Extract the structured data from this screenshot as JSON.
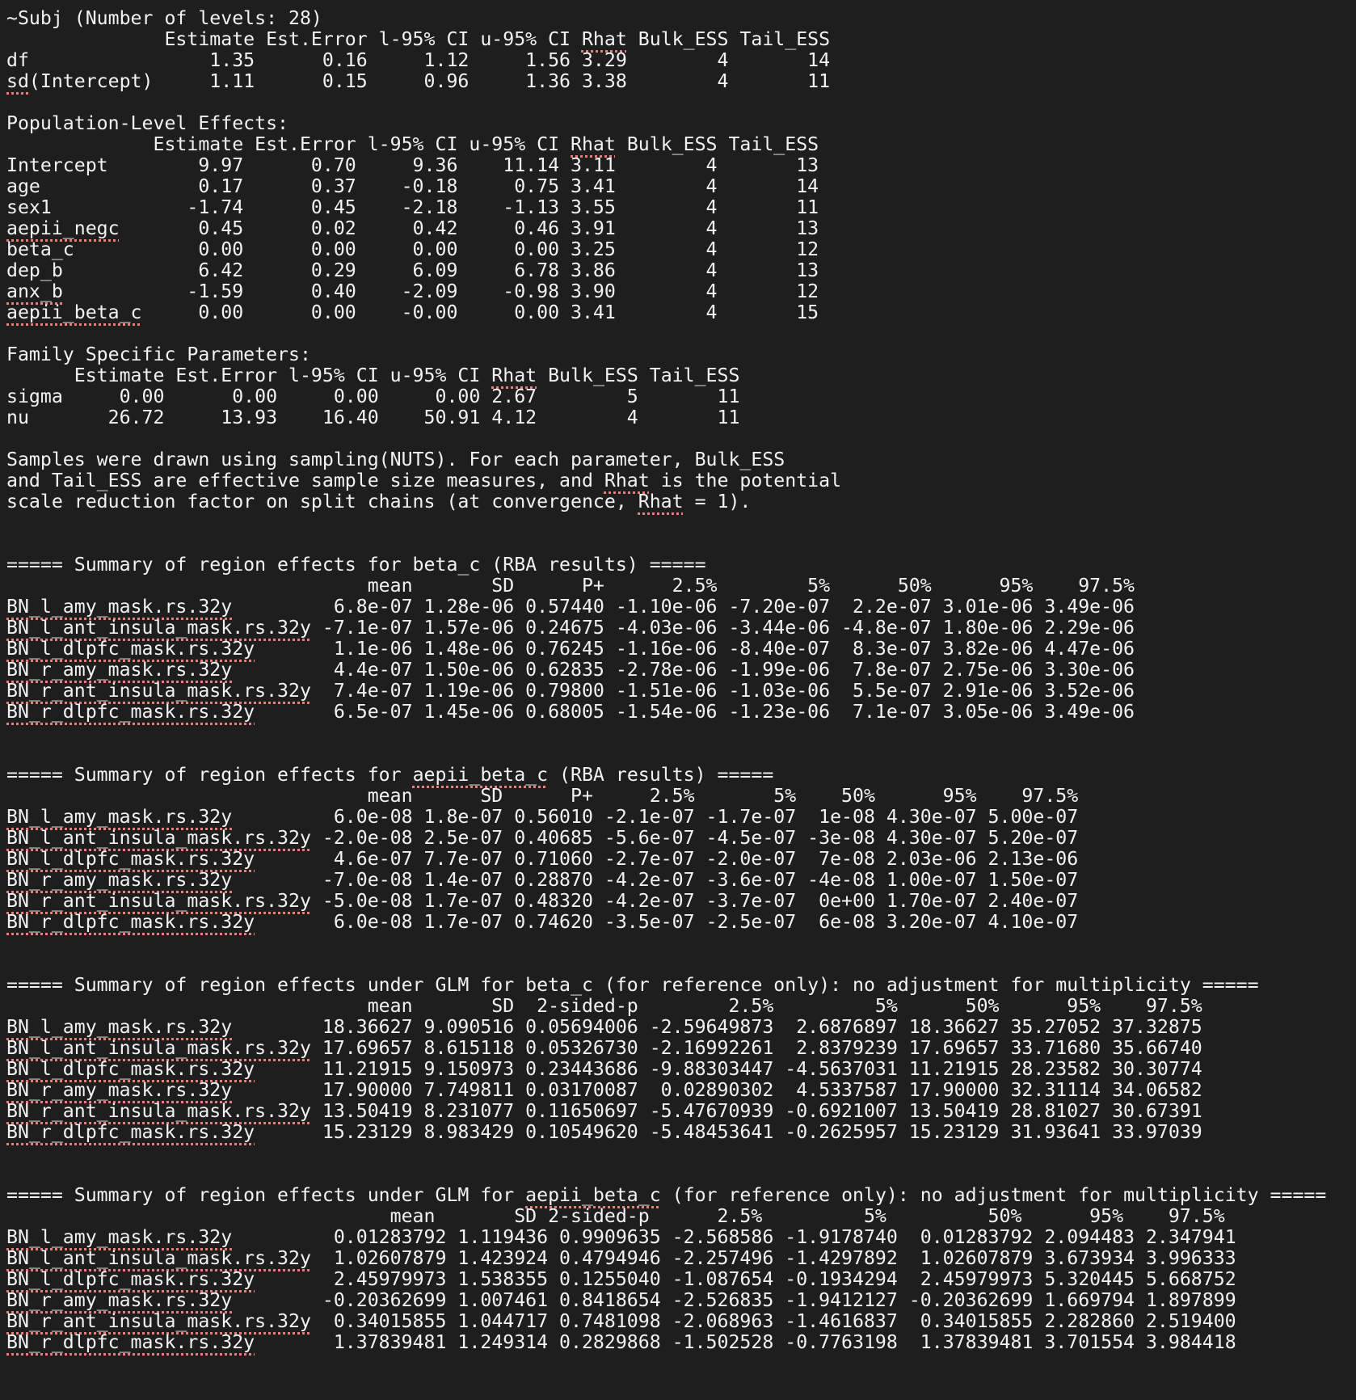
{
  "lines": [
    "~Subj (Number of levels: 28)",
    "              Estimate Est.Error l-95% CI u-95% CI Rhat Bulk_ESS Tail_ESS",
    "df                1.35      0.16     1.12     1.56 3.29        4       14",
    "sd(Intercept)     1.11      0.15     0.96     1.36 3.38        4       11",
    "",
    "Population-Level Effects:",
    "             Estimate Est.Error l-95% CI u-95% CI Rhat Bulk_ESS Tail_ESS",
    "Intercept        9.97      0.70     9.36    11.14 3.11        4       13",
    "age              0.17      0.37    -0.18     0.75 3.41        4       14",
    "sex1            -1.74      0.45    -2.18    -1.13 3.55        4       11",
    "aepii_negc       0.45      0.02     0.42     0.46 3.91        4       13",
    "beta_c           0.00      0.00     0.00     0.00 3.25        4       12",
    "dep_b            6.42      0.29     6.09     6.78 3.86        4       13",
    "anx_b           -1.59      0.40    -2.09    -0.98 3.90        4       12",
    "aepii_beta_c     0.00      0.00    -0.00     0.00 3.41        4       15",
    "",
    "Family Specific Parameters:",
    "      Estimate Est.Error l-95% CI u-95% CI Rhat Bulk_ESS Tail_ESS",
    "sigma     0.00      0.00     0.00     0.00 2.67        5       11",
    "nu       26.72     13.93    16.40    50.91 4.12        4       11",
    "",
    "Samples were drawn using sampling(NUTS). For each parameter, Bulk_ESS",
    "and Tail_ESS are effective sample size measures, and Rhat is the potential",
    "scale reduction factor on split chains (at convergence, Rhat = 1).",
    "",
    "",
    "===== Summary of region effects for beta_c (RBA results) =====",
    "                                mean       SD      P+      2.5%        5%      50%      95%    97.5%",
    "BN_l_amy_mask.rs.32y         6.8e-07 1.28e-06 0.57440 -1.10e-06 -7.20e-07  2.2e-07 3.01e-06 3.49e-06",
    "BN_l_ant_insula_mask.rs.32y -7.1e-07 1.57e-06 0.24675 -4.03e-06 -3.44e-06 -4.8e-07 1.80e-06 2.29e-06",
    "BN_l_dlpfc_mask.rs.32y       1.1e-06 1.48e-06 0.76245 -1.16e-06 -8.40e-07  8.3e-07 3.82e-06 4.47e-06",
    "BN_r_amy_mask.rs.32y         4.4e-07 1.50e-06 0.62835 -2.78e-06 -1.99e-06  7.8e-07 2.75e-06 3.30e-06",
    "BN_r_ant_insula_mask.rs.32y  7.4e-07 1.19e-06 0.79800 -1.51e-06 -1.03e-06  5.5e-07 2.91e-06 3.52e-06",
    "BN_r_dlpfc_mask.rs.32y       6.5e-07 1.45e-06 0.68005 -1.54e-06 -1.23e-06  7.1e-07 3.05e-06 3.49e-06",
    "",
    "",
    "===== Summary of region effects for aepii_beta_c (RBA results) =====",
    "                                mean      SD      P+     2.5%       5%    50%      95%    97.5%",
    "BN_l_amy_mask.rs.32y         6.0e-08 1.8e-07 0.56010 -2.1e-07 -1.7e-07  1e-08 4.30e-07 5.00e-07",
    "BN_l_ant_insula_mask.rs.32y -2.0e-08 2.5e-07 0.40685 -5.6e-07 -4.5e-07 -3e-08 4.30e-07 5.20e-07",
    "BN_l_dlpfc_mask.rs.32y       4.6e-07 7.7e-07 0.71060 -2.7e-07 -2.0e-07  7e-08 2.03e-06 2.13e-06",
    "BN_r_amy_mask.rs.32y        -7.0e-08 1.4e-07 0.28870 -4.2e-07 -3.6e-07 -4e-08 1.00e-07 1.50e-07",
    "BN_r_ant_insula_mask.rs.32y -5.0e-08 1.7e-07 0.48320 -4.2e-07 -3.7e-07  0e+00 1.70e-07 2.40e-07",
    "BN_r_dlpfc_mask.rs.32y       6.0e-08 1.7e-07 0.74620 -3.5e-07 -2.5e-07  6e-08 3.20e-07 4.10e-07",
    "",
    "",
    "===== Summary of region effects under GLM for beta_c (for reference only): no adjustment for multiplicity =====",
    "                                mean       SD  2-sided-p        2.5%         5%      50%      95%    97.5%",
    "BN_l_amy_mask.rs.32y        18.36627 9.090516 0.05694006 -2.59649873  2.6876897 18.36627 35.27052 37.32875",
    "BN_l_ant_insula_mask.rs.32y 17.69657 8.615118 0.05326730 -2.16992261  2.8379239 17.69657 33.71680 35.66740",
    "BN_l_dlpfc_mask.rs.32y      11.21915 9.150973 0.23443686 -9.88303447 -4.5637031 11.21915 28.23582 30.30774",
    "BN_r_amy_mask.rs.32y        17.90000 7.749811 0.03170087  0.02890302  4.5337587 17.90000 32.31114 34.06582",
    "BN_r_ant_insula_mask.rs.32y 13.50419 8.231077 0.11650697 -5.47670939 -0.6921007 13.50419 28.81027 30.67391",
    "BN_r_dlpfc_mask.rs.32y      15.23129 8.983429 0.10549620 -5.48453641 -0.2625957 15.23129 31.93641 33.97039",
    "",
    "",
    "===== Summary of region effects under GLM for aepii_beta_c (for reference only): no adjustment for multiplicity =====",
    "                                  mean       SD 2-sided-p      2.5%         5%         50%      95%    97.5%",
    "BN_l_amy_mask.rs.32y         0.01283792 1.119436 0.9909635 -2.568586 -1.9178740  0.01283792 2.094483 2.347941",
    "BN_l_ant_insula_mask.rs.32y  1.02607879 1.423924 0.4794946 -2.257496 -1.4297892  1.02607879 3.673934 3.996333",
    "BN_l_dlpfc_mask.rs.32y       2.45979973 1.538355 0.1255040 -1.087654 -0.1934294  2.45979973 5.320445 5.668752",
    "BN_r_amy_mask.rs.32y        -0.20362699 1.007461 0.8418654 -2.526835 -1.9412127 -0.20362699 1.669794 1.897899",
    "BN_r_ant_insula_mask.rs.32y  0.34015855 1.044717 0.7481098 -2.068963 -1.4616837  0.34015855 2.282860 2.519400",
    "BN_r_dlpfc_mask.rs.32y       1.37839481 1.249314 0.2829868 -1.502528 -0.7763198  1.37839481 3.701554 3.984418"
  ],
  "spellcheck_words": [
    "Rhat",
    "sd",
    "aepii_negc",
    "anx_b",
    "aepii_beta_c",
    "BN_l_amy_mask.rs.32y",
    "BN_l_ant_insula_mask.rs.32y",
    "BN_l_dlpfc_mask.rs.32y",
    "BN_r_amy_mask.rs.32y",
    "BN_r_ant_insula_mask.rs.32y",
    "BN_r_dlpfc_mask.rs.32y"
  ],
  "colors": {
    "background": "#1e1e1e",
    "text": "#f2f2f2",
    "spellcheck_underline": "#e08080"
  }
}
